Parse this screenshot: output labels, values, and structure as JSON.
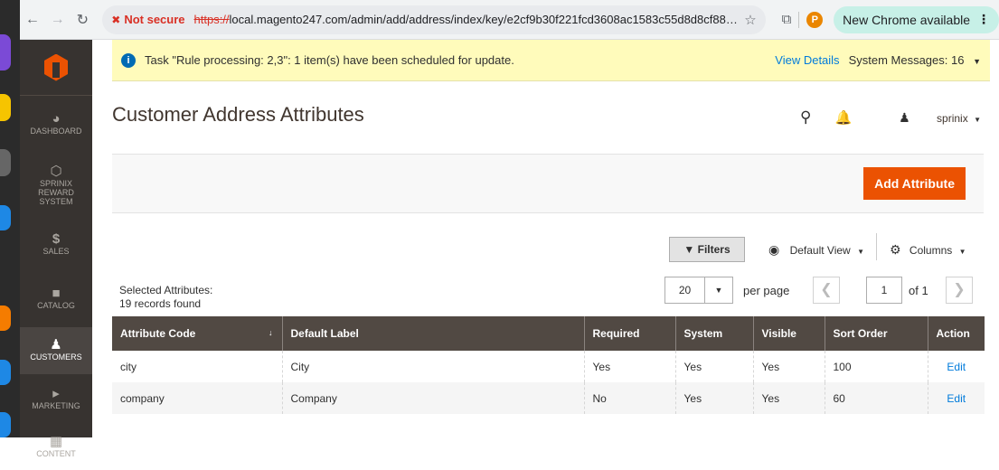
{
  "browser": {
    "not_secure_label": "Not secure",
    "url_scheme": "https://",
    "url_rest": "local.magento247.com/admin/add/address/index/key/e2cf9b30f221fcd3608ac1583c55d8d8cf884a32c...",
    "profile_initial": "P",
    "update_label": "New Chrome available"
  },
  "sidebar": {
    "items": [
      {
        "label": "DASHBOARD",
        "icon": "dashboard-icon"
      },
      {
        "label": "SPRINIX REWARD SYSTEM",
        "icon": "hexagon-icon"
      },
      {
        "label": "SALES",
        "icon": "dollar-icon"
      },
      {
        "label": "CATALOG",
        "icon": "box-icon"
      },
      {
        "label": "CUSTOMERS",
        "icon": "person-icon"
      },
      {
        "label": "MARKETING",
        "icon": "megaphone-icon"
      },
      {
        "label": "CONTENT",
        "icon": "content-icon"
      }
    ],
    "active": "CUSTOMERS"
  },
  "message": {
    "text": "Task \"Rule processing: 2,3\": 1 item(s) have been scheduled for update.",
    "view_details": "View Details",
    "system_messages": "System Messages: 16"
  },
  "header": {
    "title": "Customer Address Attributes",
    "username": "sprinix"
  },
  "actions": {
    "add_attribute": "Add Attribute"
  },
  "grid_toolbar": {
    "filters": "Filters",
    "default_view": "Default View",
    "columns": "Columns",
    "selected_label": "Selected Attributes:",
    "records_found": "19 records found",
    "per_page_value": "20",
    "per_page_label": "per page",
    "current_page": "1",
    "of_pages": "of 1"
  },
  "table": {
    "columns": [
      "Attribute Code",
      "Default Label",
      "Required",
      "System",
      "Visible",
      "Sort Order",
      "Action"
    ],
    "rows": [
      {
        "code": "city",
        "label": "City",
        "required": "Yes",
        "system": "Yes",
        "visible": "Yes",
        "sort": "100",
        "action": "Edit"
      },
      {
        "code": "company",
        "label": "Company",
        "required": "No",
        "system": "Yes",
        "visible": "Yes",
        "sort": "60",
        "action": "Edit"
      }
    ]
  },
  "colors": {
    "accent": "#eb5202",
    "sidebar_bg": "#373330",
    "table_header": "#514943",
    "link": "#007bdb",
    "message_bg": "#fffbbb"
  }
}
